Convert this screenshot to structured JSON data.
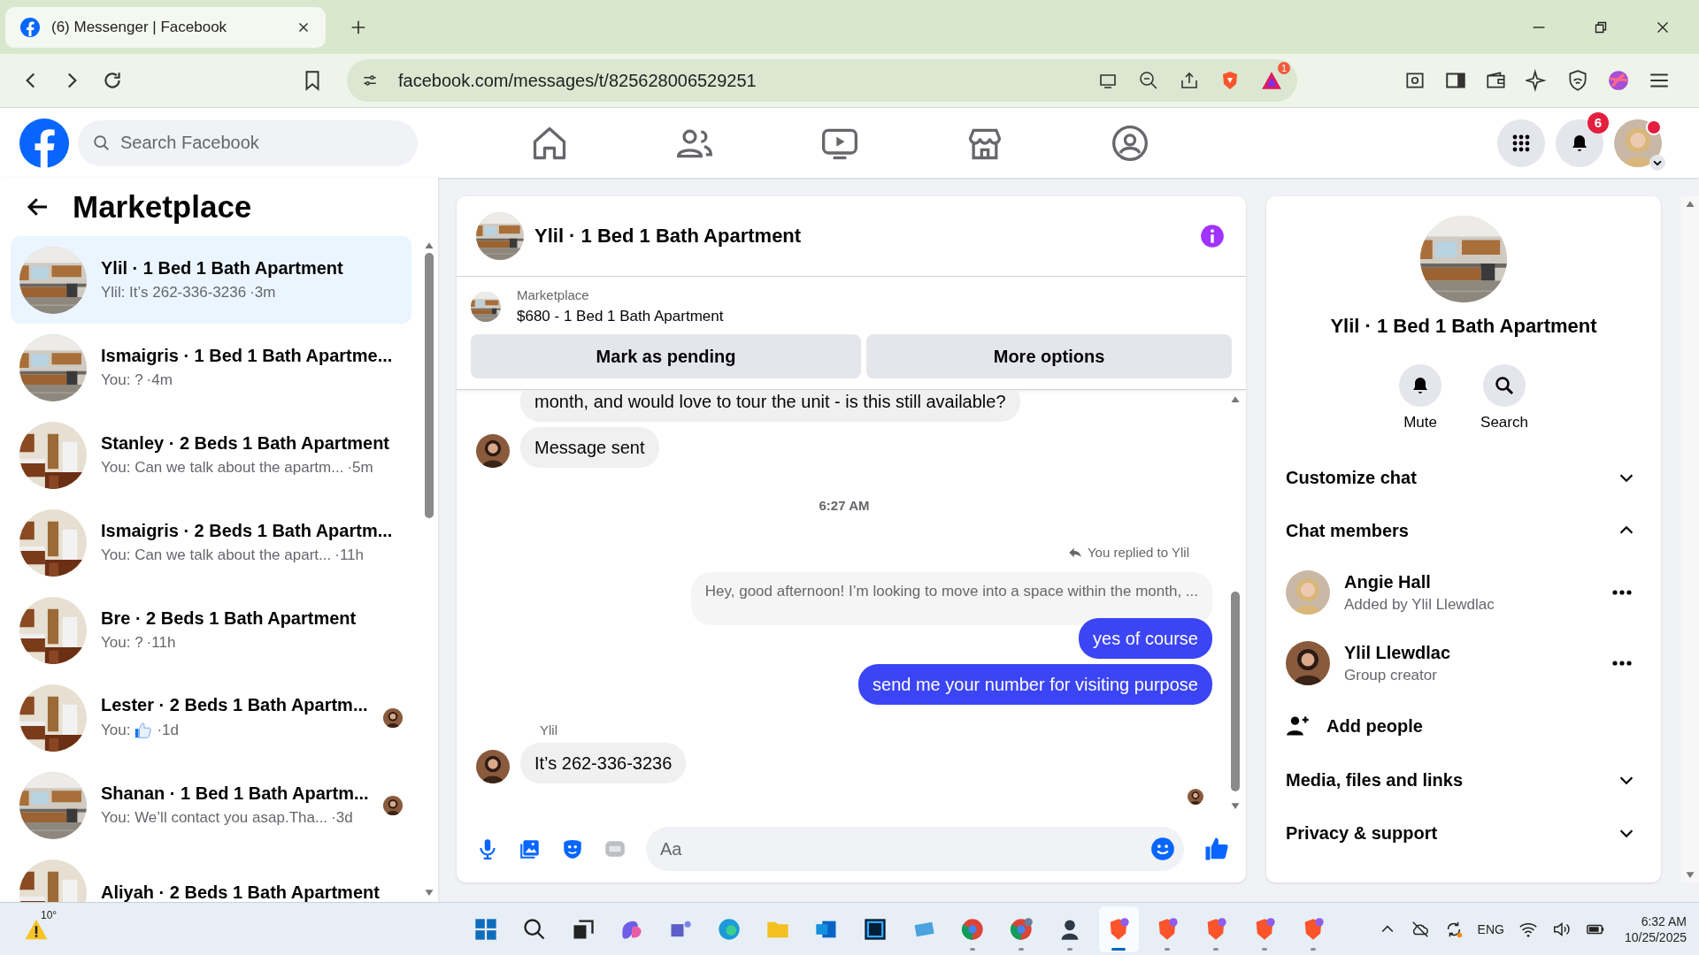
{
  "browser": {
    "tab": {
      "title": "(6) Messenger | Facebook"
    },
    "url": "facebook.com/messages/t/825628006529251",
    "extension_badge": "1"
  },
  "header": {
    "search": {
      "placeholder": "Search Facebook"
    },
    "notification_badge": "6"
  },
  "sidebar": {
    "title": "Marketplace",
    "conversations": [
      {
        "title": "Ylil · 1 Bed 1 Bath Apartment",
        "preview": "Ylil: It’s 262-336-3236",
        "time": "·3m",
        "selected": true,
        "like": false,
        "read_receipt": false
      },
      {
        "title": "Ismaigris · 1 Bed 1 Bath Apartme...",
        "preview": "You: ?",
        "time": "·4m",
        "selected": false,
        "like": false,
        "read_receipt": false
      },
      {
        "title": "Stanley · 2 Beds 1 Bath Apartment",
        "preview": "You: Can we talk about the apartm...",
        "time": "·5m",
        "selected": false,
        "like": false,
        "read_receipt": false
      },
      {
        "title": "Ismaigris · 2 Beds 1 Bath Apartm...",
        "preview": "You: Can we talk about the apart...",
        "time": "·11h",
        "selected": false,
        "like": false,
        "read_receipt": false
      },
      {
        "title": "Bre · 2 Beds 1 Bath Apartment",
        "preview": "You: ?",
        "time": "·11h",
        "selected": false,
        "like": false,
        "read_receipt": false
      },
      {
        "title": "Lester · 2 Beds 1 Bath Apartm...",
        "preview": "You:",
        "time": "·1d",
        "selected": false,
        "like": true,
        "read_receipt": true
      },
      {
        "title": "Shanan · 1 Bed 1 Bath Apartm...",
        "preview": "You: We’ll contact you asap.Tha...",
        "time": "·3d",
        "selected": false,
        "like": false,
        "read_receipt": true
      },
      {
        "title": "Aliyah · 2 Beds 1 Bath Apartment",
        "selected": false,
        "like": false,
        "read_receipt": false
      }
    ]
  },
  "chat": {
    "title": "Ylil · 1 Bed 1 Bath Apartment",
    "listing": {
      "label": "Marketplace",
      "title": "$680 - 1 Bed 1 Bath Apartment"
    },
    "buttons": [
      "Mark as pending",
      "More options"
    ],
    "messages": [
      {
        "kind": "incoming",
        "text": "month, and would love to tour the unit - is this still available?",
        "avatar": false
      },
      {
        "kind": "incoming",
        "text": "Message sent",
        "avatar": true
      },
      {
        "kind": "time",
        "text": "6:27 AM"
      },
      {
        "kind": "reply_note",
        "text": "You replied to Ylil"
      },
      {
        "kind": "quoted",
        "text": "Hey, good afternoon! I’m looking to move into a space within the month, ..."
      },
      {
        "kind": "outgoing",
        "text": "yes of course"
      },
      {
        "kind": "outgoing",
        "text": "send me your number for visiting purpose"
      },
      {
        "kind": "sender",
        "text": "Ylil"
      },
      {
        "kind": "incoming",
        "text": "It’s 262-336-3236",
        "avatar": true
      },
      {
        "kind": "seen"
      }
    ],
    "composer": {
      "placeholder": "Aa"
    }
  },
  "details": {
    "title": "Ylil · 1 Bed 1 Bath Apartment",
    "actions": [
      {
        "kind": "mute",
        "label": "Mute"
      },
      {
        "kind": "search",
        "label": "Search"
      }
    ],
    "sections": [
      {
        "label": "Customize chat",
        "expanded": false
      },
      {
        "label": "Chat members",
        "expanded": true,
        "members": [
          {
            "name": "Angie Hall",
            "role": "Added by Ylil Llewdlac"
          },
          {
            "name": "Ylil Llewdlac",
            "role": "Group creator"
          }
        ],
        "add_label": "Add people"
      },
      {
        "label": "Media, files and links",
        "expanded": false
      },
      {
        "label": "Privacy & support",
        "expanded": false
      }
    ]
  },
  "taskbar": {
    "weather": "10°",
    "language": "ENG",
    "time": "6:32 AM",
    "date": "10/25/2025",
    "apps": [
      {
        "running": false,
        "selected": false
      },
      {
        "running": false,
        "selected": false
      },
      {
        "running": false,
        "selected": false
      },
      {
        "running": false,
        "selected": false
      },
      {
        "running": false,
        "selected": false
      },
      {
        "running": false,
        "selected": false
      },
      {
        "running": false,
        "selected": false
      },
      {
        "running": false,
        "selected": false
      },
      {
        "running": false,
        "selected": false
      },
      {
        "running": false,
        "selected": false
      },
      {
        "running": true,
        "selected": false
      },
      {
        "running": true,
        "selected": false
      },
      {
        "running": true,
        "selected": false
      },
      {
        "running": true,
        "selected": true
      },
      {
        "running": true,
        "selected": false
      },
      {
        "running": true,
        "selected": false
      },
      {
        "running": true,
        "selected": false
      },
      {
        "running": true,
        "selected": false
      }
    ]
  }
}
